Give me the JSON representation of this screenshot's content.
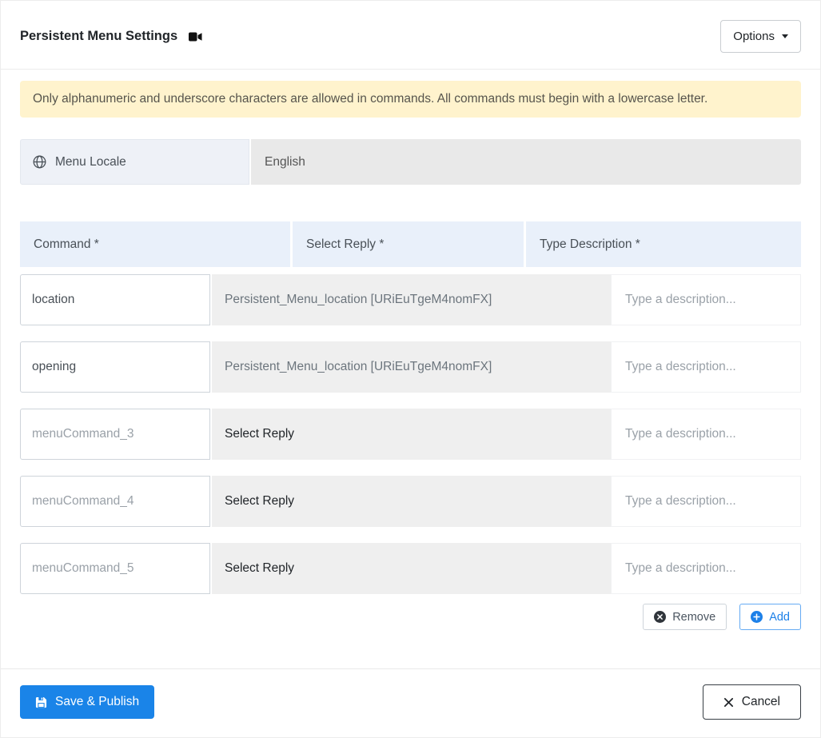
{
  "header": {
    "title": "Persistent Menu Settings",
    "options_label": "Options"
  },
  "notice": "Only alphanumeric and underscore characters are allowed in commands. All commands must begin with a lowercase letter.",
  "locale": {
    "label": "Menu Locale",
    "value": "English"
  },
  "table": {
    "headers": {
      "command": "Command *",
      "reply": "Select Reply *",
      "description": "Type Description *"
    },
    "rows": [
      {
        "command": "location",
        "reply": "Persistent_Menu_location [URiEuTgeM4nomFX]",
        "description_placeholder": "Type a description..."
      },
      {
        "command": "opening",
        "reply": "Persistent_Menu_location [URiEuTgeM4nomFX]",
        "description_placeholder": "Type a description..."
      },
      {
        "command_placeholder": "menuCommand_3",
        "reply": "Select Reply",
        "description_placeholder": "Type a description..."
      },
      {
        "command_placeholder": "menuCommand_4",
        "reply": "Select Reply",
        "description_placeholder": "Type a description..."
      },
      {
        "command_placeholder": "menuCommand_5",
        "reply": "Select Reply",
        "description_placeholder": "Type a description..."
      }
    ]
  },
  "row_actions": {
    "remove_label": "Remove",
    "add_label": "Add"
  },
  "footer": {
    "save_label": "Save & Publish",
    "cancel_label": "Cancel"
  },
  "colors": {
    "primary_blue": "#1a84e8",
    "add_blue": "#1d80e8",
    "warning_bg": "#fff3cd",
    "table_header_bg": "#e9f0fa",
    "locale_label_bg": "#eef1f7",
    "muted_bg": "#e9e9e9",
    "reply_bg": "#efefef"
  }
}
